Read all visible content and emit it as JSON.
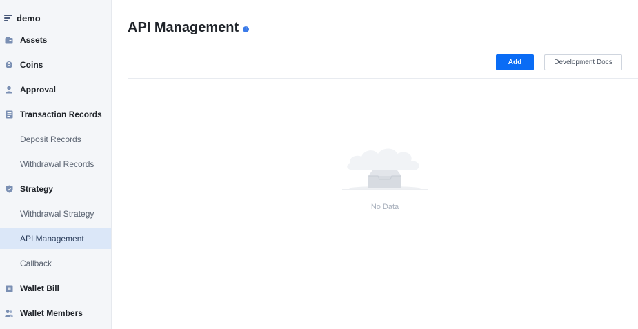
{
  "sidebar": {
    "brand": "demo",
    "items": [
      {
        "label": "Assets",
        "icon": "wallet-icon"
      },
      {
        "label": "Coins",
        "icon": "coin-icon"
      },
      {
        "label": "Approval",
        "icon": "user-icon"
      },
      {
        "label": "Transaction Records",
        "icon": "document-icon"
      },
      {
        "label": "Deposit Records"
      },
      {
        "label": "Withdrawal Records"
      },
      {
        "label": "Strategy",
        "icon": "shield-icon"
      },
      {
        "label": "Withdrawal Strategy"
      },
      {
        "label": "API Management",
        "active": true
      },
      {
        "label": "Callback"
      },
      {
        "label": "Wallet Bill",
        "icon": "bill-icon"
      },
      {
        "label": "Wallet Members",
        "icon": "members-icon"
      }
    ]
  },
  "header": {
    "title": "API Management",
    "info_icon": "info-icon"
  },
  "toolbar": {
    "add_label": "Add",
    "docs_label": "Development Docs"
  },
  "empty_state": {
    "text": "No Data",
    "icon": "empty-inbox-icon"
  },
  "colors": {
    "primary": "#0a6cf5",
    "sidebar_bg": "#f4f6f9",
    "active_bg": "#dbe7f8",
    "icon": "#7a8fb3"
  }
}
